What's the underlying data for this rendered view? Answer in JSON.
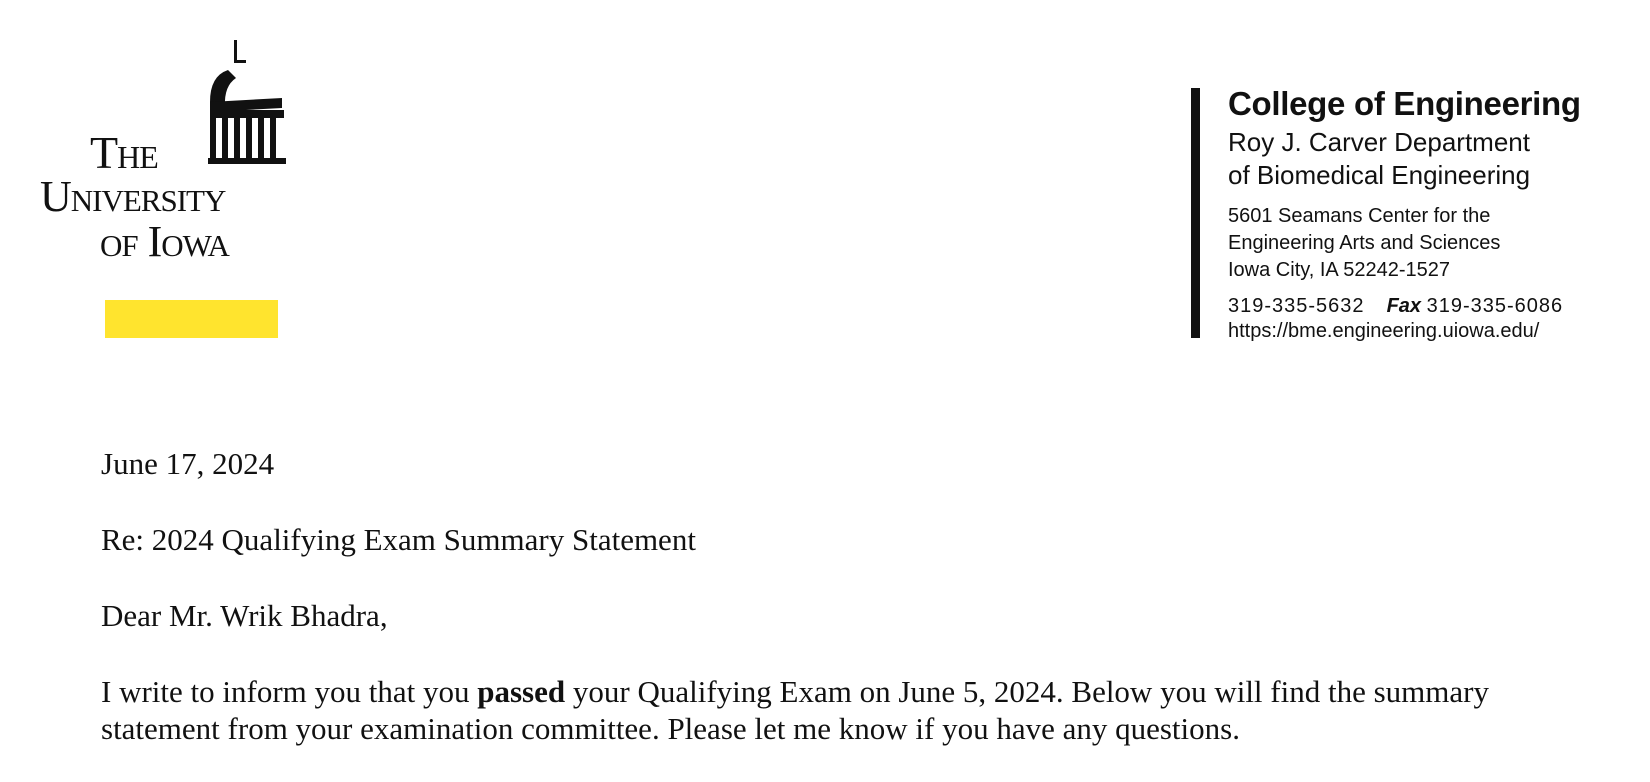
{
  "logo": {
    "line1": "The",
    "line2": "University",
    "line3": "of Iowa",
    "accent_color": "#FFE42E"
  },
  "department": {
    "college": "College of Engineering",
    "dept_line1": "Roy J. Carver Department",
    "dept_line2": "of Biomedical Engineering",
    "address_line1": "5601 Seamans Center for the",
    "address_line2": "Engineering Arts and Sciences",
    "address_line3": "Iowa City, IA 52242-1527",
    "phone": "319-335-5632",
    "fax_label": "Fax",
    "fax": "319-335-6086",
    "website": "https://bme.engineering.uiowa.edu/"
  },
  "letter": {
    "date": "June 17, 2024",
    "subject": "Re: 2024 Qualifying Exam Summary Statement",
    "salutation": "Dear Mr. Wrik Bhadra,",
    "body_before": "I write to inform you that you ",
    "body_bold": "passed",
    "body_after": " your Qualifying Exam on June 5, 2024. Below you will find the summary statement from your examination committee. Please let me know if you have any questions."
  }
}
